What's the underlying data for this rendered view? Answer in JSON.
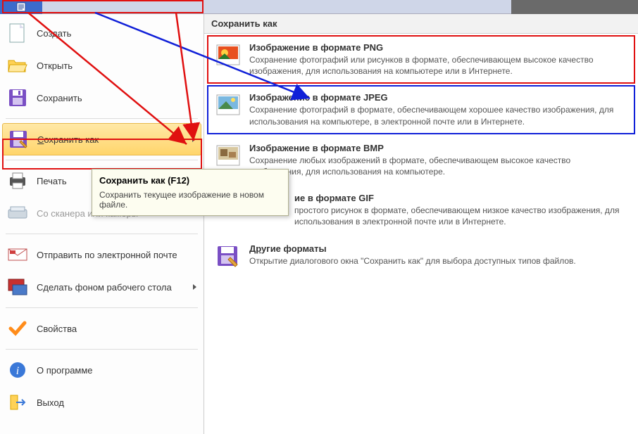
{
  "panel": {
    "title": "Сохранить как"
  },
  "menu": {
    "create": "Создать",
    "open": "Открыть",
    "save": "Сохранить",
    "save_as": "Сохранить как",
    "print": "Печать",
    "scanner": "Со сканера или камеры",
    "email": "Отправить по электронной почте",
    "wallpaper": "Сделать фоном рабочего стола",
    "properties": "Свойства",
    "about": "О программе",
    "exit": "Выход"
  },
  "tooltip": {
    "title": "Сохранить как (F12)",
    "body": "Сохранить текущее изображение в новом файле."
  },
  "formats": {
    "png": {
      "title": "Изображение в формате PNG",
      "desc": "Сохранение фотографий или рисунков в формате, обеспечивающем высокое качество изображения, для использования на компьютере или в Интернете."
    },
    "jpeg": {
      "title": "Изображение в формате JPEG",
      "desc": "Сохранение фотографий в формате, обеспечивающем хорошее качество изображения, для использования на компьютере, в электронной почте или в Интернете."
    },
    "bmp": {
      "title": "Изображение в формате BMP",
      "desc": "Сохранение любых изображений в формате, обеспечивающем высокое качество изображения, для использования на компьютере."
    },
    "gif": {
      "title": "Изображение в формате GIF",
      "desc_suffix": "простого рисунок в формате, обеспечивающем низкое качество изображения, для использования в электронной почте или в Интернете."
    },
    "other": {
      "title": "Другие форматы",
      "desc": "Открытие диалогового окна \"Сохранить как\" для выбора доступных типов файлов."
    }
  }
}
